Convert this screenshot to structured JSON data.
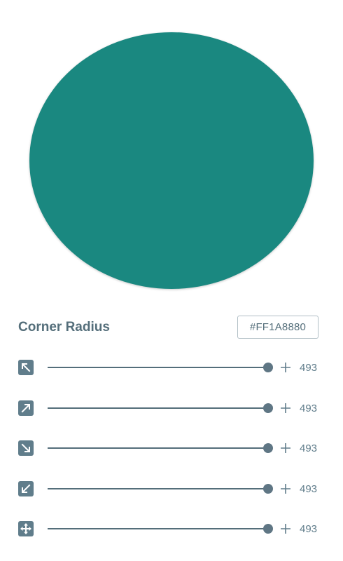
{
  "preview": {
    "color": "#1a8880"
  },
  "corner_radius": {
    "title": "Corner Radius",
    "hex_value": "#FF1A8880"
  },
  "sliders": [
    {
      "icon": "arrow-up-left-icon",
      "value": "493",
      "level": 1.0
    },
    {
      "icon": "arrow-up-right-icon",
      "value": "493",
      "level": 1.0
    },
    {
      "icon": "arrow-down-right-icon",
      "value": "493",
      "level": 1.0
    },
    {
      "icon": "arrow-down-left-icon",
      "value": "493",
      "level": 1.0
    },
    {
      "icon": "move-all-icon",
      "value": "493",
      "level": 1.0
    }
  ],
  "colors": {
    "accent": "#607d8b",
    "shape": "#1a8880"
  }
}
